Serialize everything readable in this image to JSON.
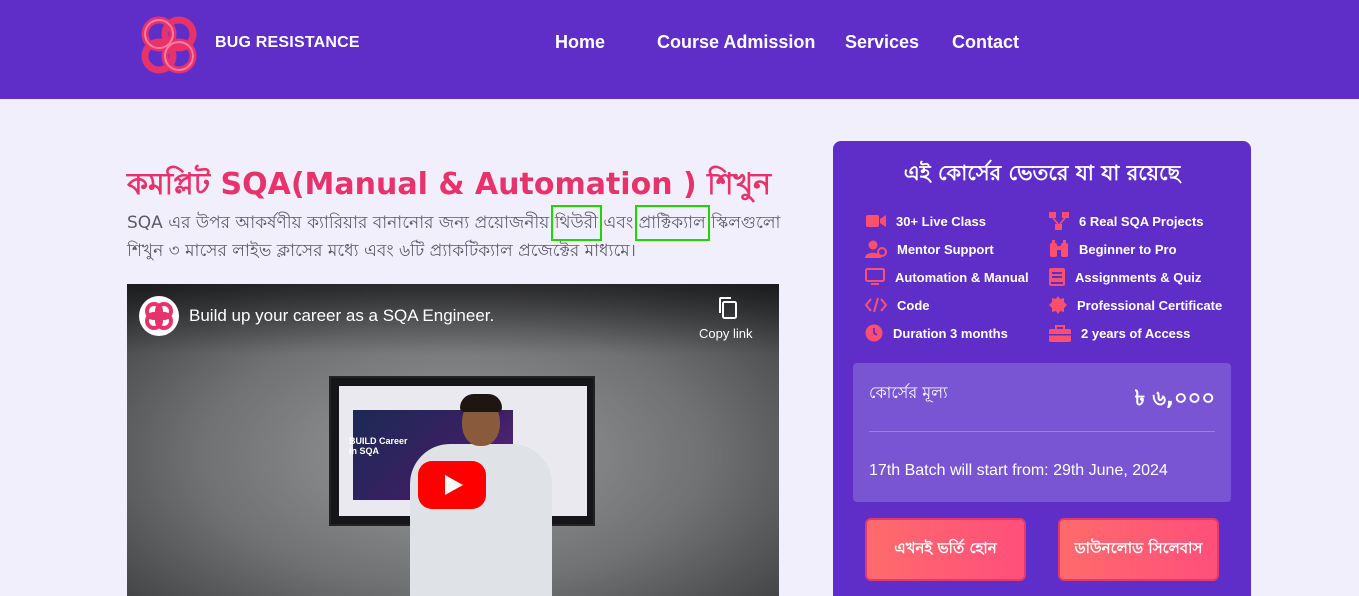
{
  "header": {
    "brand": "BUG RESISTANCE",
    "nav": [
      "Home",
      "Course Admission",
      "Services",
      "Contact"
    ]
  },
  "hero": {
    "title": "কমপ্লিট SQA(Manual & Automation ) শিখুন",
    "desc_part1": "SQA এর উপর আকর্ষণীয় ক্যারিয়ার বানানোর জন্য প্রয়োজনীয় ",
    "desc_hl1": "থিউরী",
    "desc_part2": " এবং ",
    "desc_hl2": "প্রাক্টিক্যাল",
    "desc_part3": " স্কিলগুলো শিখুন ৩ মাসের লাইভ ক্লাসের মধ্যে এবং ৬টি প্র্যাকটিক্যাল প্রজেক্টের মাধ্যমে।"
  },
  "video": {
    "title": "Build up your career as a SQA Engineer.",
    "copy_link": "Copy link",
    "screen_text": "BUILD Career in SQA"
  },
  "course_card": {
    "title": "এই কোর্সের ভেতরে যা যা রয়েছে",
    "features": [
      {
        "label": "30+ Live Class",
        "icon": "video-camera-icon"
      },
      {
        "label": "6 Real SQA Projects",
        "icon": "project-diagram-icon"
      },
      {
        "label": "Mentor Support",
        "icon": "user-support-icon"
      },
      {
        "label": "Beginner to Pro",
        "icon": "binoculars-icon"
      },
      {
        "label": "Automation & Manual",
        "icon": "desktop-icon"
      },
      {
        "label": "Assignments & Quiz",
        "icon": "book-icon"
      },
      {
        "label": "Code",
        "icon": "code-icon"
      },
      {
        "label": "Professional Certificate",
        "icon": "certificate-icon"
      },
      {
        "label": "Duration 3 months",
        "icon": "clock-icon"
      },
      {
        "label": "2 years of Access",
        "icon": "toolbox-icon"
      }
    ],
    "price_label": "কোর্সের মূল্য",
    "price_value": "৳ ৬,০০০",
    "batch": "17th Batch will start from: 29th June, 2024",
    "enroll_button": "এখনই ভর্তি হোন",
    "syllabus_button": "ডাউনলোড সিলেবাস"
  },
  "colors": {
    "header_bg": "#5f2ec8",
    "accent_pink": "#e8326c",
    "card_bg": "#5f2ec8",
    "price_box_bg": "#7a55d3",
    "feature_icon": "#ff4f6e",
    "page_bg": "#f1effb",
    "highlight_outline": "#1fd700"
  }
}
